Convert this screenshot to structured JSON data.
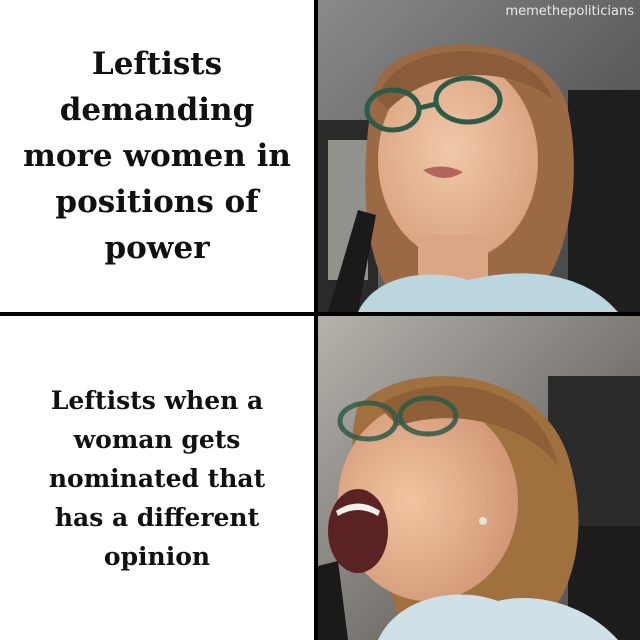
{
  "panels": {
    "top_caption": "Leftists demanding more women in positions of power",
    "bottom_caption": "Leftists when a woman gets nominated that has a different opinion"
  },
  "watermark": "memethepoliticians",
  "colors": {
    "background": "#ffffff",
    "divider": "#000000",
    "text": "#111111"
  }
}
